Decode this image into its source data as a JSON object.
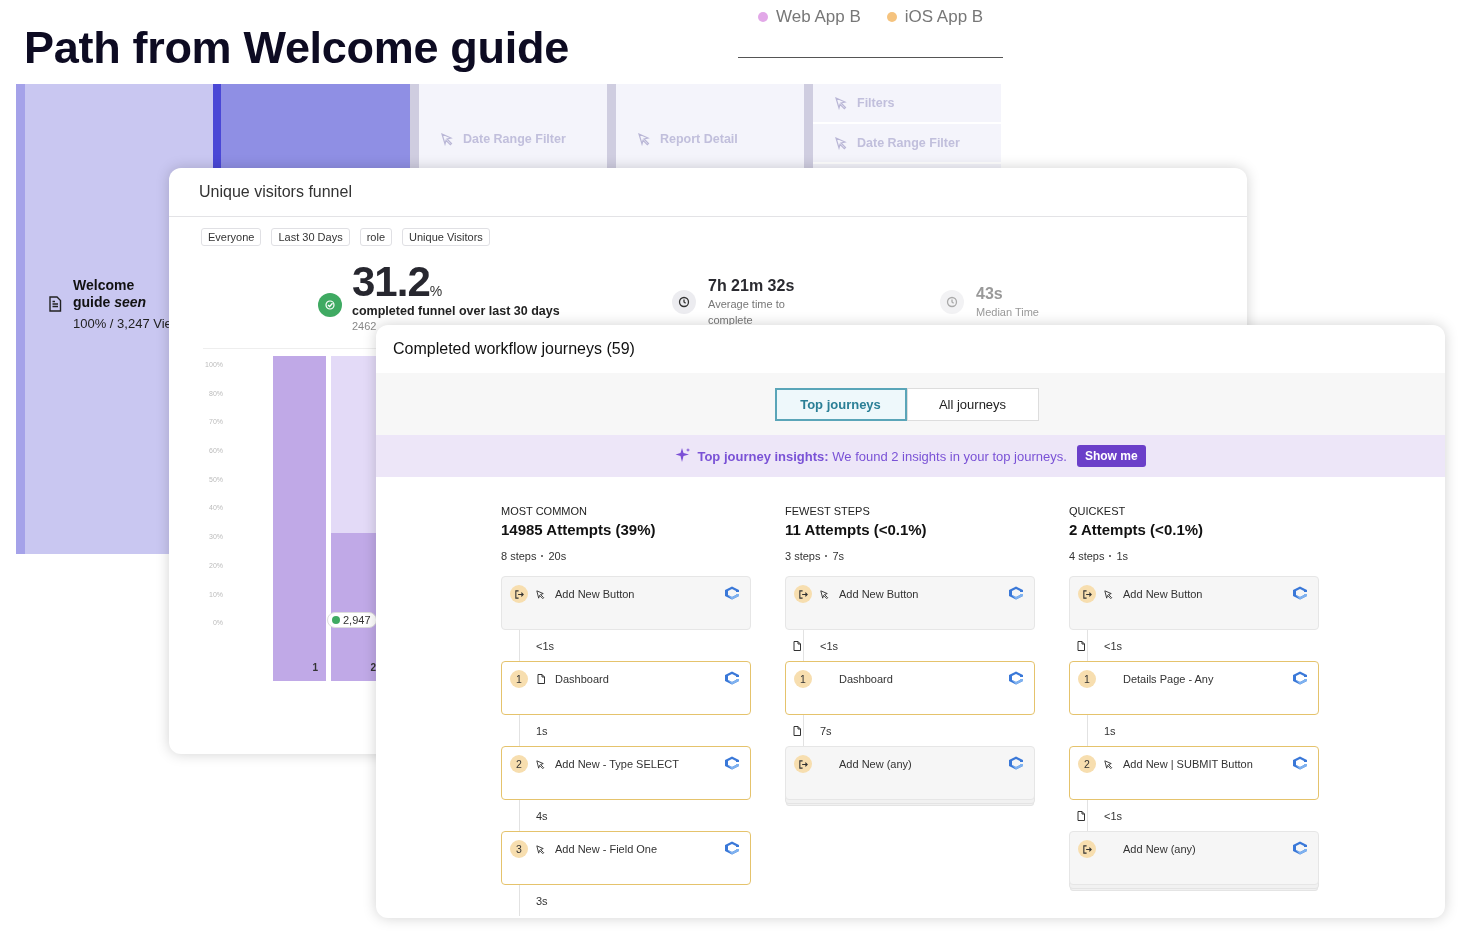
{
  "title": "Path from Welcome guide",
  "legend": [
    {
      "label": "Web App B",
      "color": "#e2a8e8"
    },
    {
      "label": "iOS App B",
      "color": "#f5c37e"
    }
  ],
  "path_columns": [
    {
      "kind": "start",
      "label": "Welcome guide *seen*",
      "stat": "100% / 3,247 Vie"
    },
    {
      "kind": "active"
    },
    {
      "kind": "faded",
      "steps": [
        "Date Range Filter"
      ]
    },
    {
      "kind": "faded",
      "steps": [
        "Report Detail"
      ]
    },
    {
      "kind": "faded_split",
      "steps": [
        "Filters",
        "Date Range Filter"
      ]
    }
  ],
  "funnel": {
    "title": "Unique visitors funnel",
    "filters": [
      "Everyone",
      "Last 30 Days",
      "role",
      "Unique Visitors"
    ],
    "conversion": {
      "value": "31.2",
      "unit": "%",
      "label": "completed funnel over last 30 days",
      "detail": "2462"
    },
    "times": [
      {
        "value": "7h 21m 32s",
        "label": "Average time to complete",
        "muted": false
      },
      {
        "value": "43s",
        "label": "Median Time",
        "muted": true
      }
    ],
    "chart": {
      "y_ticks": [
        "100%",
        "80%",
        "70%",
        "60%",
        "50%",
        "40%",
        "30%",
        "20%",
        "10%",
        "0%"
      ],
      "bars": [
        {
          "label": "1",
          "kind": "full"
        },
        {
          "label": "2",
          "kind": "split"
        }
      ],
      "badge": "2,947"
    }
  },
  "journeys": {
    "title": "Completed workflow journeys (59)",
    "tabs": [
      {
        "label": "Top journeys",
        "selected": true
      },
      {
        "label": "All journeys",
        "selected": false
      }
    ],
    "insight": {
      "text": "**Top journey insights:** We found 2 insights in your top journeys.",
      "button": "Show me"
    },
    "columns": [
      {
        "label": "MOST COMMON",
        "attempts": "14985 Attempts (39%)",
        "steps": "8 steps",
        "duration": "20s",
        "path": [
          {
            "kind": "node",
            "exit": true,
            "pointer_icon": true,
            "page_icon": false,
            "label": "Add New Button",
            "stacked": false
          },
          {
            "kind": "gap",
            "time": "<1s",
            "page_icon": false
          },
          {
            "kind": "node",
            "exit": false,
            "number": "1",
            "pointer_icon": false,
            "page_icon": true,
            "label": "Dashboard",
            "stacked": false
          },
          {
            "kind": "gap",
            "time": "1s",
            "page_icon": false
          },
          {
            "kind": "node",
            "exit": false,
            "number": "2",
            "pointer_icon": true,
            "page_icon": false,
            "label": "Add New - Type SELECT",
            "stacked": false
          },
          {
            "kind": "gap",
            "time": "4s",
            "page_icon": false
          },
          {
            "kind": "node",
            "exit": false,
            "number": "3",
            "pointer_icon": true,
            "page_icon": false,
            "label": "Add New - Field One",
            "stacked": false
          },
          {
            "kind": "gap",
            "time": "3s",
            "page_icon": false
          }
        ]
      },
      {
        "label": "FEWEST STEPS",
        "attempts": "11 Attempts (<0.1%)",
        "steps": "3 steps",
        "duration": "7s",
        "path": [
          {
            "kind": "node",
            "exit": true,
            "pointer_icon": true,
            "page_icon": false,
            "label": "Add New Button",
            "stacked": false
          },
          {
            "kind": "gap",
            "time": "<1s",
            "page_icon": true
          },
          {
            "kind": "node",
            "exit": false,
            "number": "1",
            "pointer_icon": false,
            "page_icon": false,
            "label": "Dashboard",
            "stacked": false
          },
          {
            "kind": "gap",
            "time": "7s",
            "page_icon": true
          },
          {
            "kind": "node",
            "exit": true,
            "pointer_icon": false,
            "page_icon": false,
            "label": "Add New (any)",
            "stacked": true
          }
        ]
      },
      {
        "label": "QUICKEST",
        "attempts": "2 Attempts (<0.1%)",
        "steps": "4 steps",
        "duration": "1s",
        "path": [
          {
            "kind": "node",
            "exit": true,
            "pointer_icon": true,
            "page_icon": false,
            "label": "Add New Button",
            "stacked": false
          },
          {
            "kind": "gap",
            "time": "<1s",
            "page_icon": true
          },
          {
            "kind": "node",
            "exit": false,
            "number": "1",
            "pointer_icon": false,
            "page_icon": false,
            "label": "Details Page - Any",
            "stacked": false
          },
          {
            "kind": "gap",
            "time": "1s",
            "page_icon": false
          },
          {
            "kind": "node",
            "exit": false,
            "number": "2",
            "pointer_icon": true,
            "page_icon": false,
            "label": "Add New | SUBMIT Button",
            "stacked": false
          },
          {
            "kind": "gap",
            "time": "<1s",
            "page_icon": true
          },
          {
            "kind": "node",
            "exit": true,
            "pointer_icon": false,
            "page_icon": false,
            "label": "Add New (any)",
            "stacked": true
          }
        ]
      }
    ]
  }
}
